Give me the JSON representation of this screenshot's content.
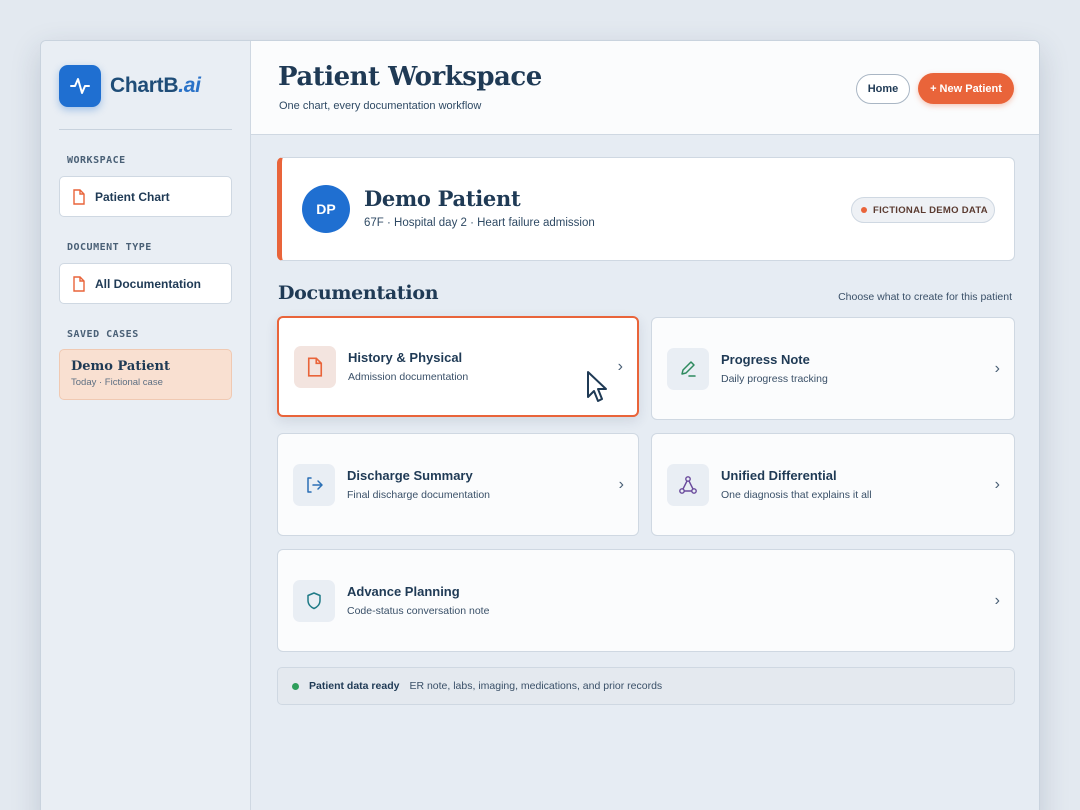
{
  "brand": {
    "name_main": "ChartB",
    "name_ai": ".ai",
    "logo_icon": "pulse-icon"
  },
  "sidebar": {
    "workspace_label": "WORKSPACE",
    "workspace_item": "Patient Chart",
    "doctype_label": "DOCUMENT TYPE",
    "doctype_item": "All Documentation",
    "saved_label": "SAVED CASES",
    "saved_case": {
      "title": "Demo Patient",
      "subtitle": "Today · Fictional case"
    }
  },
  "header": {
    "title": "Patient Workspace",
    "subtitle": "One chart, every documentation workflow",
    "home_label": "Home",
    "new_patient_label": "+ New Patient"
  },
  "patient": {
    "initials": "DP",
    "name": "Demo Patient",
    "meta": "67F · Hospital day 2 · Heart failure admission",
    "badge": "FICTIONAL DEMO DATA"
  },
  "documentation": {
    "title": "Documentation",
    "hint": "Choose what to create for this patient",
    "cards": [
      {
        "title": "History & Physical",
        "subtitle": "Admission documentation",
        "icon": "file-icon"
      },
      {
        "title": "Progress Note",
        "subtitle": "Daily progress tracking",
        "icon": "pen-icon"
      },
      {
        "title": "Discharge Summary",
        "subtitle": "Final discharge documentation",
        "icon": "exit-icon"
      },
      {
        "title": "Unified Differential",
        "subtitle": "One diagnosis that explains it all",
        "icon": "network-icon"
      },
      {
        "title": "Advance Planning",
        "subtitle": "Code-status conversation note",
        "icon": "shield-icon"
      }
    ]
  },
  "status": {
    "label": "Patient data ready",
    "text": "ER note, labs, imaging, medications, and prior records"
  },
  "colors": {
    "accent": "#e9643a",
    "brand": "#1f6fd1",
    "text": "#1f3a55",
    "ready": "#2e9e5b"
  }
}
